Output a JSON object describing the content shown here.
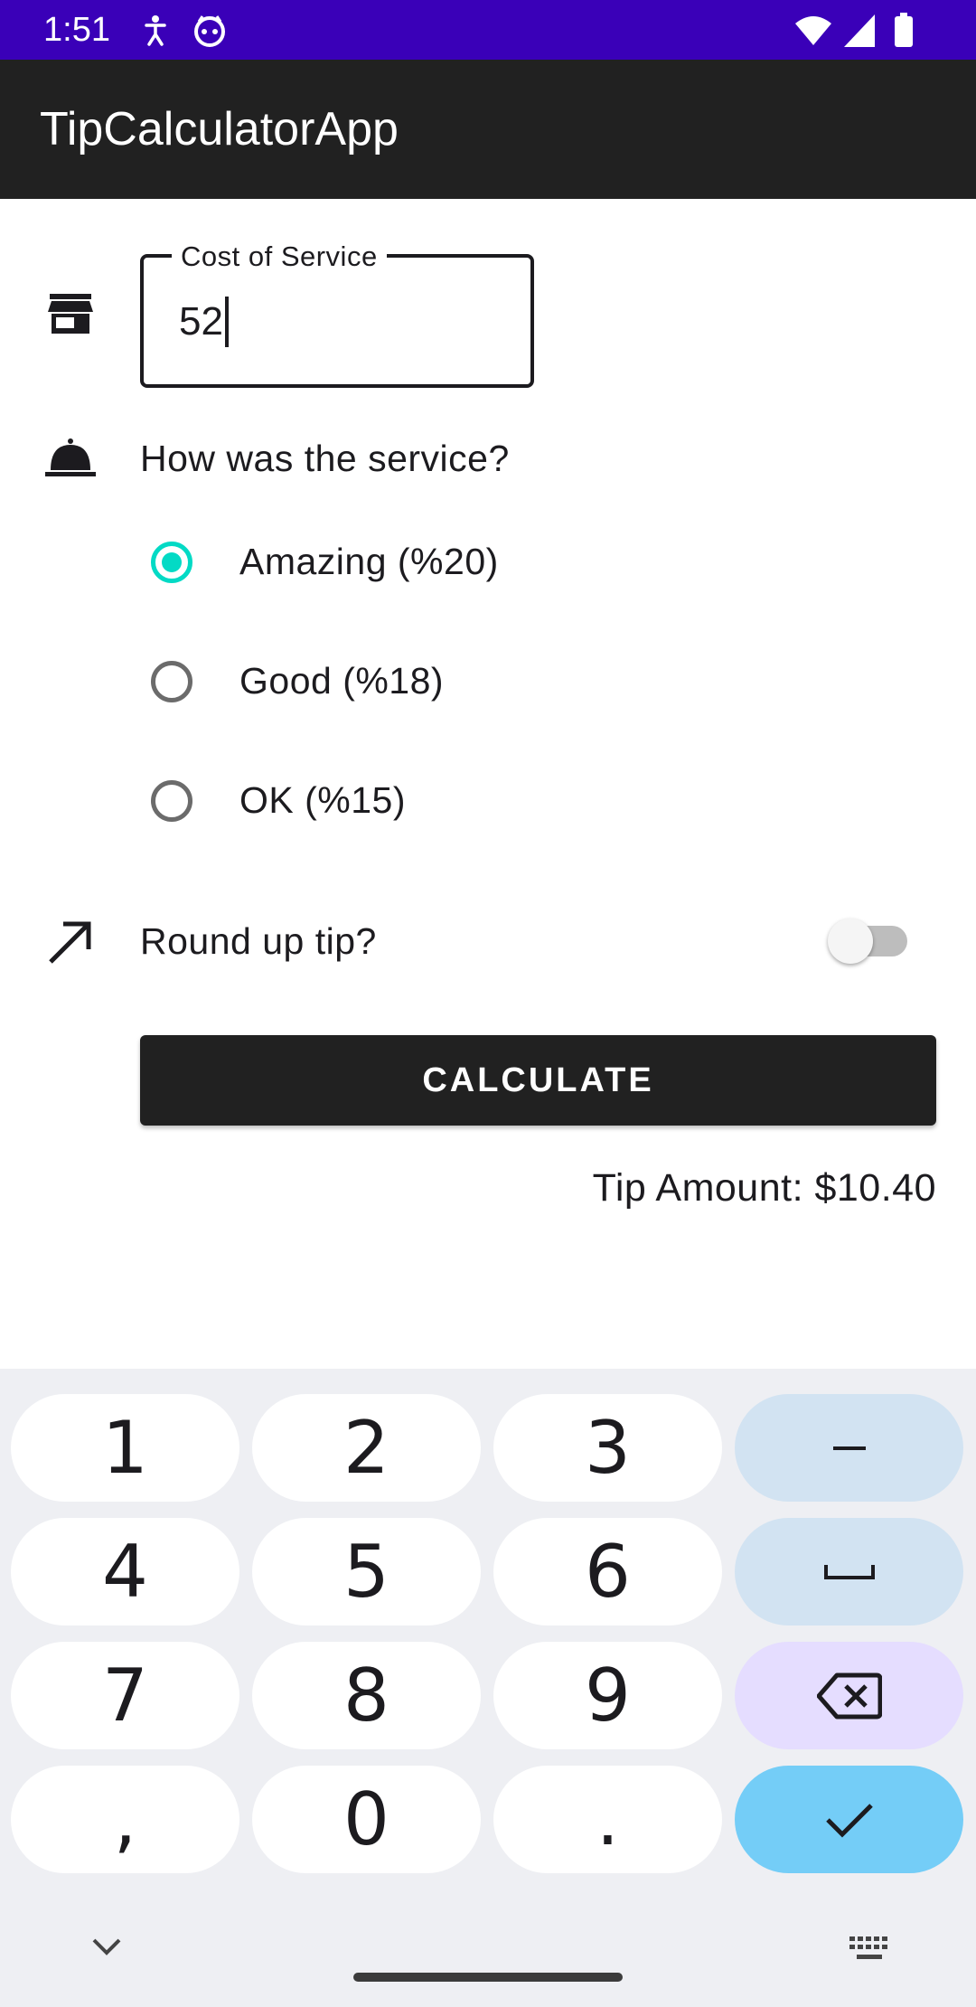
{
  "status_bar": {
    "time": "1:51",
    "left_icons": [
      "accessibility-icon",
      "android-face-icon"
    ],
    "right_icons": [
      "wifi-icon",
      "cell-signal-icon",
      "battery-icon"
    ],
    "background": "#3a00b8"
  },
  "app_bar": {
    "title": "TipCalculatorApp",
    "background": "#212121"
  },
  "cost_field": {
    "label": "Cost of Service",
    "value": "52",
    "icon": "store-icon"
  },
  "service": {
    "question": "How was the service?",
    "icon": "room-service-icon",
    "options": [
      {
        "label": "Amazing (%20)",
        "selected": true
      },
      {
        "label": "Good (%18)",
        "selected": false
      },
      {
        "label": "OK (%15)",
        "selected": false
      }
    ],
    "accent": "#03dac5"
  },
  "round_up": {
    "label": "Round up tip?",
    "icon": "trending-arrow-icon",
    "checked": false
  },
  "calculate_button": {
    "label": "CALCULATE"
  },
  "result": {
    "text": "Tip Amount: $10.40"
  },
  "keyboard": {
    "rows": [
      [
        "1",
        "2",
        "3",
        "–"
      ],
      [
        "4",
        "5",
        "6",
        "␣"
      ],
      [
        "7",
        "8",
        "9",
        "⌫"
      ],
      [
        ",",
        "0",
        ".",
        "✓"
      ]
    ],
    "colors": {
      "digit": "#ffffff",
      "symbol": "#d2e3f2",
      "backspace": "#e5ddff",
      "enter": "#74cdf7",
      "background": "#eeeff3"
    }
  }
}
